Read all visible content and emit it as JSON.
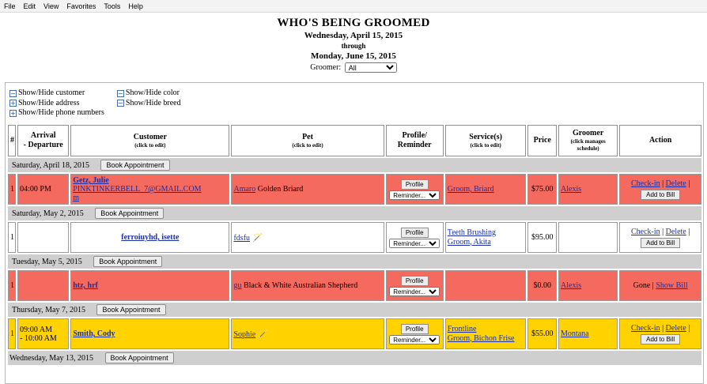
{
  "menu": [
    "File",
    "Edit",
    "View",
    "Favorites",
    "Tools",
    "Help"
  ],
  "header": {
    "title": "WHO'S BEING GROOMED",
    "start_date": "Wednesday, April 15, 2015",
    "through": "through",
    "end_date": "Monday, June 15, 2015",
    "groomer_label": "Groomer:",
    "groomer_value": "All"
  },
  "toggles": {
    "customer": "Show/Hide customer",
    "address": "Show/Hide address",
    "phone": "Show/Hide phone numbers",
    "color": "Show/Hide color",
    "breed": "Show/Hide breed"
  },
  "columns": {
    "num": "#",
    "arrival": "Arrival",
    "departure": "-  Departure",
    "customer": "Customer",
    "customer_sub": "(click to edit)",
    "pet": "Pet",
    "pet_sub": "(click to edit)",
    "profile": "Profile/",
    "reminder": "Reminder",
    "services": "Service(s)",
    "services_sub": "(click to edit)",
    "price": "Price",
    "groomer": "Groomer",
    "groomer_sub": "(click manages schedule)",
    "action": "Action"
  },
  "labels": {
    "book": "Book Appointment",
    "profile": "Profile",
    "reminder": "Reminder...",
    "checkin": "Check-in",
    "delete": "Delete",
    "add_bill": "Add to Bill",
    "gone": "Gone",
    "show_bill": "Show Bill",
    "sep": " | "
  },
  "groups": [
    {
      "date": "Saturday, April 18, 2015",
      "appt": {
        "num": "1",
        "time": "04:00 PM",
        "time2": "",
        "customer": "Getz, Julie",
        "email": "PINKTINKERBELL_7@GMAIL.COM",
        "email2": "m",
        "pet": "Amaro",
        "pet_desc": "Golden Briard",
        "service1": "Groom, Briard",
        "service2": "",
        "price": "$75.00",
        "groomer": "Alexis"
      }
    },
    {
      "date": "Saturday, May 2, 2015",
      "appt": {
        "num": "1",
        "time": "",
        "time2": "",
        "customer": "ferroiuyhd, isette",
        "pet": "fdsfu",
        "service1": "Teeth Brushing",
        "service2": "Groom, Akita",
        "price": "$95.00",
        "groomer": ""
      }
    },
    {
      "date": "Tuesday, May 5, 2015",
      "appt": {
        "num": "1",
        "customer": "htz, hrf",
        "pet": "gu",
        "pet_desc": "Black & White Australian Shepherd",
        "price": "$0.00",
        "groomer": "Alexis"
      }
    },
    {
      "date": "Thursday, May 7, 2015",
      "appt": {
        "num": "1",
        "time": "09:00 AM",
        "time2": "-  10:00 AM",
        "customer": "Smith, Cody",
        "pet": "Sophie",
        "service1": "Frontline",
        "service2": "Groom, Bichon Frise",
        "price": "$55.00",
        "groomer": "Montana"
      }
    },
    {
      "date": "Wednesday, May 13, 2015"
    }
  ]
}
